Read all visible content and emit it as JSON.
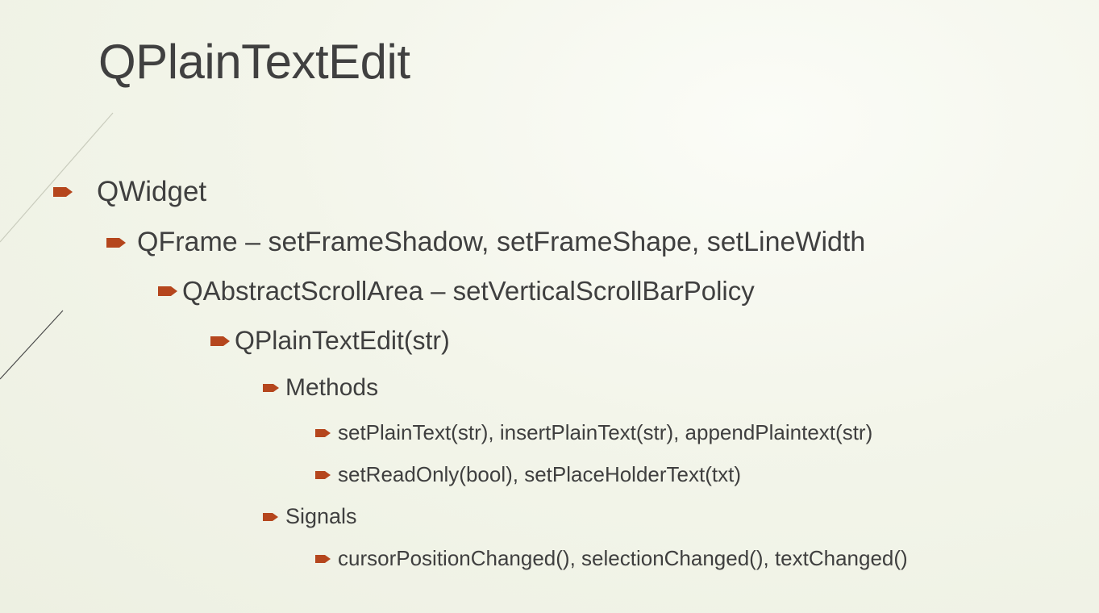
{
  "slide": {
    "title": "QPlainTextEdit",
    "accent_color": "#b5461d",
    "bullet_icon": "arrow-bullet-icon",
    "bullets": [
      {
        "level": 1,
        "text": "QWidget"
      },
      {
        "level": 2,
        "text": "QFrame – setFrameShadow, setFrameShape, setLineWidth"
      },
      {
        "level": 3,
        "text": "QAbstractScrollArea – setVerticalScrollBarPolicy"
      },
      {
        "level": 4,
        "text": "QPlainTextEdit(str)"
      },
      {
        "level": 5,
        "text": "Methods"
      },
      {
        "level": 6,
        "text": "setPlainText(str), insertPlainText(str), appendPlaintext(str)"
      },
      {
        "level": 6,
        "text": "setReadOnly(bool), setPlaceHolderText(txt)"
      },
      {
        "level": 5,
        "text": "Signals"
      },
      {
        "level": 6,
        "text": "cursorPositionChanged(), selectionChanged(), textChanged()"
      }
    ]
  }
}
